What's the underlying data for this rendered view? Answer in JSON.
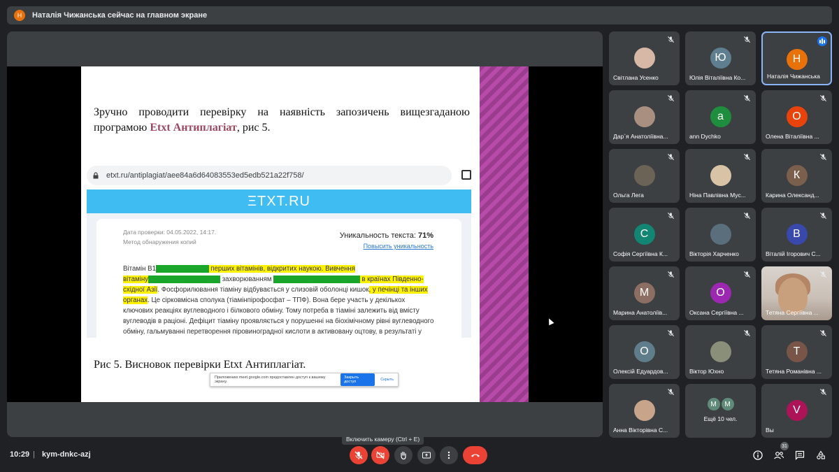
{
  "banner": {
    "avatar_letter": "Н",
    "text": "Наталія Чижанська сейчас на главном экране"
  },
  "slide": {
    "paragraph_pre": "Зручно проводити перевірку на наявність запозичень вищезгаданою програмою ",
    "paragraph_highlight": "Etxt Антиплагіат",
    "paragraph_post": ", рис 5.",
    "url": "etxt.ru/antiplagiat/aee84a6d64083553ed5edb521a22f758/",
    "brand": "ΞTXT.RU",
    "check_date": "Дата проверки: 04.05.2022, 14:17.",
    "method": "Метод обнаружения копий",
    "uniqueness_label": "Уникальность текста: ",
    "uniqueness_value": "71%",
    "improve_link": "Повысить уникальность",
    "text_segments": [
      {
        "t": "Вітамін В1",
        "c": ""
      },
      {
        "t": "░░░░░░░░░░░",
        "c": "g"
      },
      {
        "t": " перших вітамінів, відкритих наукою. Вивчення вітаміну",
        "c": "y"
      },
      {
        "t": "░░░░░",
        "c": "g"
      },
      {
        "t": "░░░░░░░░░░",
        "c": "g"
      },
      {
        "t": " захворюванням ",
        "c": ""
      },
      {
        "t": "░░░░░░░░░░░░░░░░░░",
        "c": "g"
      },
      {
        "t": " в країнах Південно-східної Азії",
        "c": "y"
      },
      {
        "t": ". Фосфорилювання тіаміну відбувається у слизовій оболонці кишок",
        "c": ""
      },
      {
        "t": ", у печінці та інших органах",
        "c": "y"
      },
      {
        "t": ". Це сірковмісна сполука (тіамінпірофосфат – ТПФ). Вона бере участь у декількох ключових реакціях вуглеводного і білкового обміну. Тому потреба в тіаміні залежить від вмісту вуглеводів в раціоні. Дефіцит тіаміну проявляється у порушенні на біохімічному рівні вуглеводного обміну, гальмуванні перетворення піровиноградної кислоти в активовану оцтову, в результаті у тканинах накопичуються проміжні продукти",
        "c": ""
      }
    ],
    "caption": "Рис 5. Висновок перевірки Etxt Антиплагіат.",
    "share_text": "Приложению meet.google.com предоставлен доступ к вашему экрану.",
    "share_stop": "Закрыть доступ",
    "share_hide": "Скрыть"
  },
  "participants": [
    {
      "name": "Світлана Усенко",
      "letter": "",
      "color": "#d7b8a6",
      "photo": true
    },
    {
      "name": "Юлія Віталіївна Ко...",
      "letter": "Ю",
      "color": "#5f7f90"
    },
    {
      "name": "Наталія Чижанська",
      "letter": "Н",
      "color": "#e8710a",
      "speaking": true
    },
    {
      "name": "Дар`я Анатоліївна...",
      "letter": "",
      "color": "#a88f80",
      "photo": true
    },
    {
      "name": "ann Dychko",
      "letter": "a",
      "color": "#1e8e3e"
    },
    {
      "name": "Олена Віталіївна ...",
      "letter": "О",
      "color": "#e8430a"
    },
    {
      "name": "Ольга Лега",
      "letter": "",
      "color": "#6b6456",
      "photo": true
    },
    {
      "name": "Ніна Павлівна Мус...",
      "letter": "",
      "color": "#d9c3a7",
      "photo": true
    },
    {
      "name": "Карина Олександ...",
      "letter": "К",
      "color": "#7a5f4d"
    },
    {
      "name": "Софія Сергіївна К...",
      "letter": "С",
      "color": "#128573"
    },
    {
      "name": "Вікторія Харченко",
      "letter": "",
      "color": "#5a6e7c",
      "photo": true
    },
    {
      "name": "Віталій Ігорович С...",
      "letter": "В",
      "color": "#3949ab"
    },
    {
      "name": "Марина Анатоліїв...",
      "letter": "М",
      "color": "#8d6e63"
    },
    {
      "name": "Оксана Сергіївна ...",
      "letter": "О",
      "color": "#9c27b0"
    },
    {
      "name": "Тетяна Сергіївна ...",
      "letter": "",
      "color": "",
      "video": true
    },
    {
      "name": "Олексій Едуардов...",
      "letter": "О",
      "color": "#607d8b"
    },
    {
      "name": "Віктор Юхно",
      "letter": "",
      "color": "#8a8f7a",
      "photo": true
    },
    {
      "name": "Тетяна Романівна ...",
      "letter": "Т",
      "color": "#795548"
    },
    {
      "name": "Анна Вікторівна С...",
      "letter": "",
      "color": "#c8a58a",
      "photo": true
    },
    {
      "name": "Ещё 10 чел.",
      "letter": "",
      "color": "",
      "more": true,
      "more_letters": [
        "М",
        "М"
      ]
    },
    {
      "name": "Вы",
      "letter": "V",
      "color": "#ad1457"
    }
  ],
  "bottom": {
    "time": "10:29",
    "meeting_code": "kym-dnkc-azj",
    "tooltip": "Включить камеру (Ctrl + E)",
    "people_count": "31"
  },
  "colors": {
    "red": "#ea4335",
    "accent": "#8ab4f8",
    "bg": "#202124"
  }
}
